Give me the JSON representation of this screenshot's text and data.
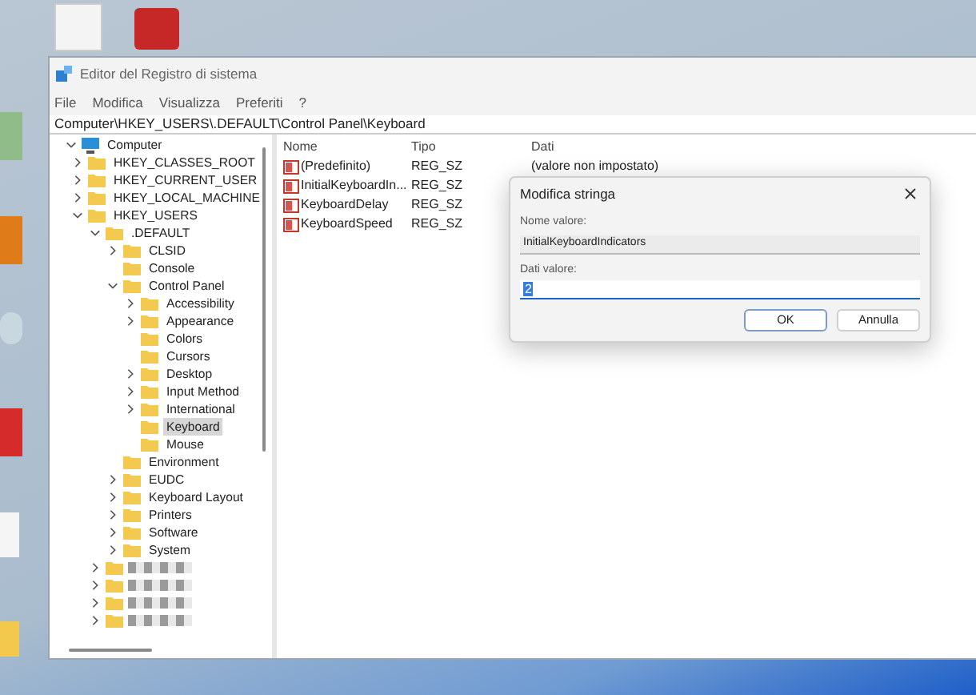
{
  "window": {
    "title": "Editor del Registro di sistema"
  },
  "menu": [
    "File",
    "Modifica",
    "Visualizza",
    "Preferiti",
    "?"
  ],
  "address": "Computer\\HKEY_USERS\\.DEFAULT\\Control Panel\\Keyboard",
  "tree": [
    {
      "label": "Computer",
      "kind": "computer",
      "expanded": true,
      "selected": false,
      "children": [
        {
          "label": "HKEY_CLASSES_ROOT",
          "kind": "branch",
          "expanded": false,
          "selected": false
        },
        {
          "label": "HKEY_CURRENT_USER",
          "kind": "branch",
          "expanded": false,
          "selected": false
        },
        {
          "label": "HKEY_LOCAL_MACHINE",
          "kind": "branch",
          "expanded": false,
          "selected": false
        },
        {
          "label": "HKEY_USERS",
          "kind": "branch",
          "expanded": true,
          "selected": false,
          "children": [
            {
              "label": ".DEFAULT",
              "kind": "branch",
              "expanded": true,
              "selected": false,
              "children": [
                {
                  "label": "CLSID",
                  "kind": "branch",
                  "expanded": false,
                  "selected": false
                },
                {
                  "label": "Console",
                  "kind": "leaf",
                  "selected": false
                },
                {
                  "label": "Control Panel",
                  "kind": "branch",
                  "expanded": true,
                  "selected": false,
                  "children": [
                    {
                      "label": "Accessibility",
                      "kind": "branch",
                      "expanded": false,
                      "selected": false
                    },
                    {
                      "label": "Appearance",
                      "kind": "branch",
                      "expanded": false,
                      "selected": false
                    },
                    {
                      "label": "Colors",
                      "kind": "leaf",
                      "selected": false
                    },
                    {
                      "label": "Cursors",
                      "kind": "leaf",
                      "selected": false
                    },
                    {
                      "label": "Desktop",
                      "kind": "branch",
                      "expanded": false,
                      "selected": false
                    },
                    {
                      "label": "Input Method",
                      "kind": "branch",
                      "expanded": false,
                      "selected": false
                    },
                    {
                      "label": "International",
                      "kind": "branch",
                      "expanded": false,
                      "selected": false
                    },
                    {
                      "label": "Keyboard",
                      "kind": "leaf",
                      "selected": true
                    },
                    {
                      "label": "Mouse",
                      "kind": "leaf",
                      "selected": false
                    }
                  ]
                },
                {
                  "label": "Environment",
                  "kind": "leaf",
                  "selected": false
                },
                {
                  "label": "EUDC",
                  "kind": "branch",
                  "expanded": false,
                  "selected": false
                },
                {
                  "label": "Keyboard Layout",
                  "kind": "branch",
                  "expanded": false,
                  "selected": false
                },
                {
                  "label": "Printers",
                  "kind": "branch",
                  "expanded": false,
                  "selected": false
                },
                {
                  "label": "Software",
                  "kind": "branch",
                  "expanded": false,
                  "selected": false
                },
                {
                  "label": "System",
                  "kind": "branch",
                  "expanded": false,
                  "selected": false
                }
              ]
            },
            {
              "kind": "redacted",
              "expanded": false,
              "selected": false
            },
            {
              "kind": "redacted",
              "expanded": false,
              "selected": false
            },
            {
              "kind": "redacted",
              "expanded": false,
              "selected": false
            },
            {
              "kind": "redacted",
              "expanded": false,
              "selected": false
            }
          ]
        }
      ]
    }
  ],
  "columns": [
    "Nome",
    "Tipo",
    "Dati"
  ],
  "values": [
    {
      "name": "(Predefinito)",
      "type": "REG_SZ",
      "data": "(valore non impostato)"
    },
    {
      "name": "InitialKeyboardIn...",
      "type": "REG_SZ"
    },
    {
      "name": "KeyboardDelay",
      "type": "REG_SZ"
    },
    {
      "name": "KeyboardSpeed",
      "type": "REG_SZ"
    }
  ],
  "dialog": {
    "title": "Modifica stringa",
    "name_label": "Nome valore:",
    "name_value": "InitialKeyboardIndicators",
    "data_label": "Dati valore:",
    "data_value": "2",
    "buttons": [
      {
        "label": "OK",
        "default": true
      },
      {
        "label": "Annulla",
        "default": false
      }
    ]
  }
}
